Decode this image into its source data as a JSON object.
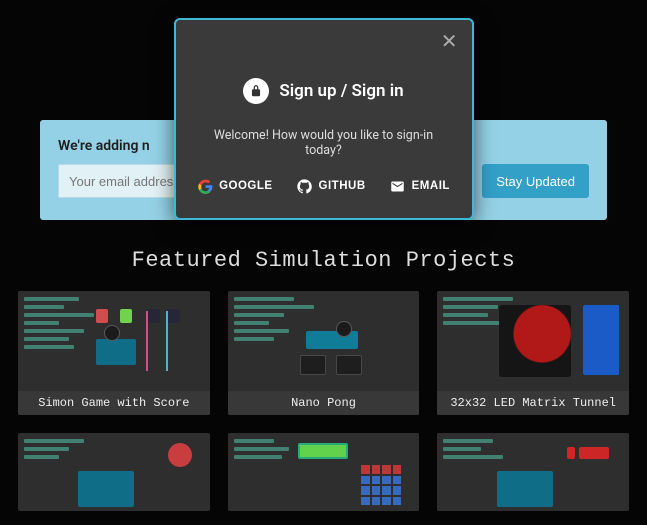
{
  "signup": {
    "heading": "We're adding n",
    "email_placeholder": "Your email address",
    "button": "Stay Updated"
  },
  "featured": {
    "heading": "Featured Simulation Projects",
    "projects": [
      {
        "title": "Simon Game with Score"
      },
      {
        "title": "Nano Pong"
      },
      {
        "title": "32x32 LED Matrix Tunnel"
      },
      {
        "title": ""
      },
      {
        "title": ""
      },
      {
        "title": ""
      }
    ]
  },
  "modal": {
    "title": "Sign up / Sign in",
    "welcome": "Welcome! How would you like to sign-in today?",
    "google": "GOOGLE",
    "github": "GITHUB",
    "email": "EMAIL"
  }
}
